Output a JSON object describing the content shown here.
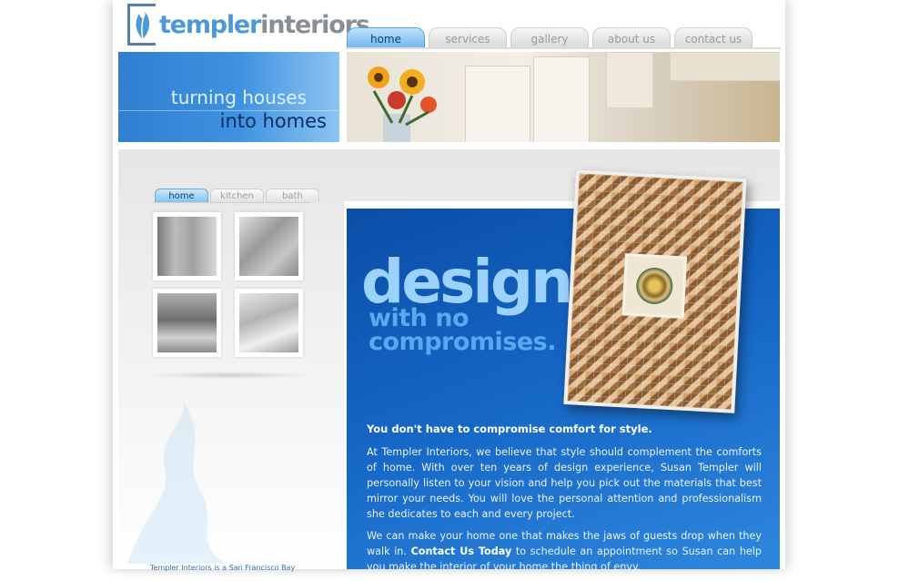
{
  "brand": {
    "name_part1": "templer",
    "name_part2": "interiors"
  },
  "nav": {
    "tabs": [
      {
        "label": "home",
        "active": true
      },
      {
        "label": "services",
        "active": false
      },
      {
        "label": "gallery",
        "active": false
      },
      {
        "label": "about us",
        "active": false
      },
      {
        "label": "contact us",
        "active": false
      }
    ]
  },
  "tagline": {
    "line1": "turning houses",
    "line2": "into homes"
  },
  "gallery": {
    "tabs": [
      {
        "label": "home",
        "active": true
      },
      {
        "label": "kitchen",
        "active": false
      },
      {
        "label": "bath",
        "active": false
      }
    ]
  },
  "feature": {
    "headline": "design.",
    "subheadline_line1": "with no",
    "subheadline_line2": "compromises.",
    "lead": "You don't have to compromise comfort for style.",
    "paragraph1": "At Templer Interiors, we believe that style should complement the comforts of home. With over ten years of design experience, Susan Templer will personally listen to your vision and help you pick out the materials that best mirror your needs. You will love the personal attention and professionalism she dedicates to each and every project.",
    "paragraph2_before": "We can make your home one that makes the jaws of guests drop when they walk in.",
    "paragraph2_link": "Contact Us Today",
    "paragraph2_after": "to schedule an appointment so Susan can help you make the interior of your home the thing of envy."
  },
  "footer": {
    "text": "Templer Interiors is a San Francisco Bay"
  },
  "colors": {
    "accent": "#1465c4",
    "light_blue": "#4d99d8",
    "tab_active": "#6fb5eb"
  }
}
